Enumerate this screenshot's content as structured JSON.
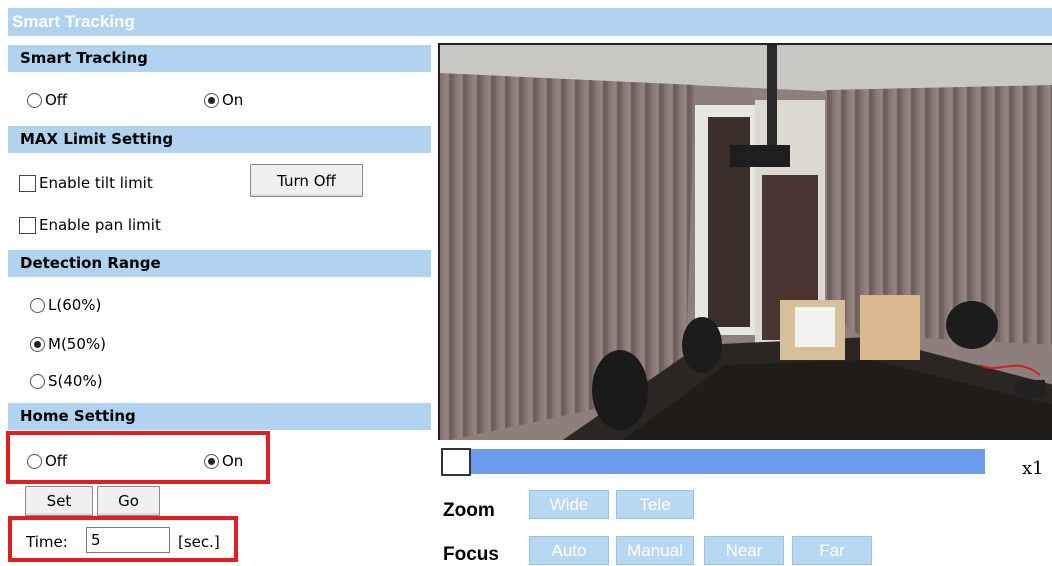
{
  "title": "Smart Tracking",
  "smart_tracking": {
    "header": "Smart Tracking",
    "off_label": "Off",
    "on_label": "On",
    "selected": "On"
  },
  "max_limit": {
    "header": "MAX Limit Setting",
    "tilt_label": "Enable tilt limit",
    "pan_label": "Enable pan limit",
    "tilt_checked": false,
    "pan_checked": false,
    "turn_off_label": "Turn Off"
  },
  "detection_range": {
    "header": "Detection Range",
    "options": [
      "L(60%)",
      "M(50%)",
      "S(40%)"
    ],
    "selected": "M(50%)"
  },
  "home_setting": {
    "header": "Home Setting",
    "off_label": "Off",
    "on_label": "On",
    "selected": "On",
    "set_label": "Set",
    "go_label": "Go",
    "time_label": "Time:",
    "time_value": "5",
    "time_unit": "[sec.]"
  },
  "zoom": {
    "label": "Zoom",
    "wide_label": "Wide",
    "tele_label": "Tele",
    "level": "x1"
  },
  "focus": {
    "label": "Focus",
    "auto_label": "Auto",
    "manual_label": "Manual",
    "near_label": "Near",
    "far_label": "Far"
  },
  "colors": {
    "header_bg": "#b2d3ef",
    "highlight": "#e02020",
    "slider": "#6e9cef",
    "ctrl_button": "#b8d7f2"
  }
}
